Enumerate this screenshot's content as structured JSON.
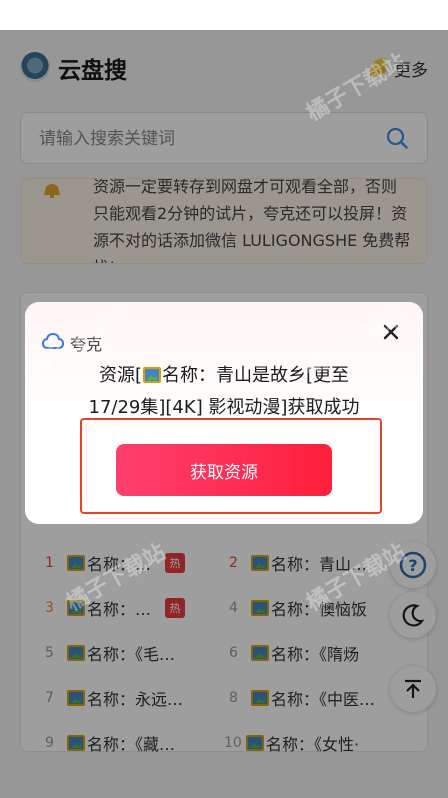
{
  "header": {
    "title": "云盘搜",
    "more_label": "更多"
  },
  "search": {
    "placeholder": "请输入搜索关键词"
  },
  "notice": {
    "text": "资源一定要转存到网盘才可观看全部，否则只能观看2分钟的试片，夸克还可以投屏！资源不对的话添加微信 LULIGONGSHE 免费帮找!"
  },
  "ranking": {
    "items": [
      {
        "rank": "1",
        "title": "名称：…",
        "hot": "热"
      },
      {
        "rank": "2",
        "title": "名称：青山…"
      },
      {
        "rank": "3",
        "title": "名称：…",
        "hot": "热"
      },
      {
        "rank": "4",
        "title": "名称：懊恼饭"
      },
      {
        "rank": "5",
        "title": "名称：《毛…"
      },
      {
        "rank": "6",
        "title": "名称：《隋炀"
      },
      {
        "rank": "7",
        "title": "名称：永远…"
      },
      {
        "rank": "8",
        "title": "名称：《中医…"
      },
      {
        "rank": "9",
        "title": "名称：《藏…"
      },
      {
        "rank": "10",
        "title": "名称：《女性·"
      }
    ]
  },
  "modal": {
    "source": "夸克",
    "message_line1_prefix": "资源[",
    "message_line1_suffix": "名称：青山是故乡[更至",
    "message_line2": "17/29集][4K] 影视动漫]获取成功",
    "action_label": "获取资源"
  },
  "watermark_text": "橘子下载站",
  "colors": {
    "accent": "#ff2449",
    "highlight": "#e1452c"
  }
}
